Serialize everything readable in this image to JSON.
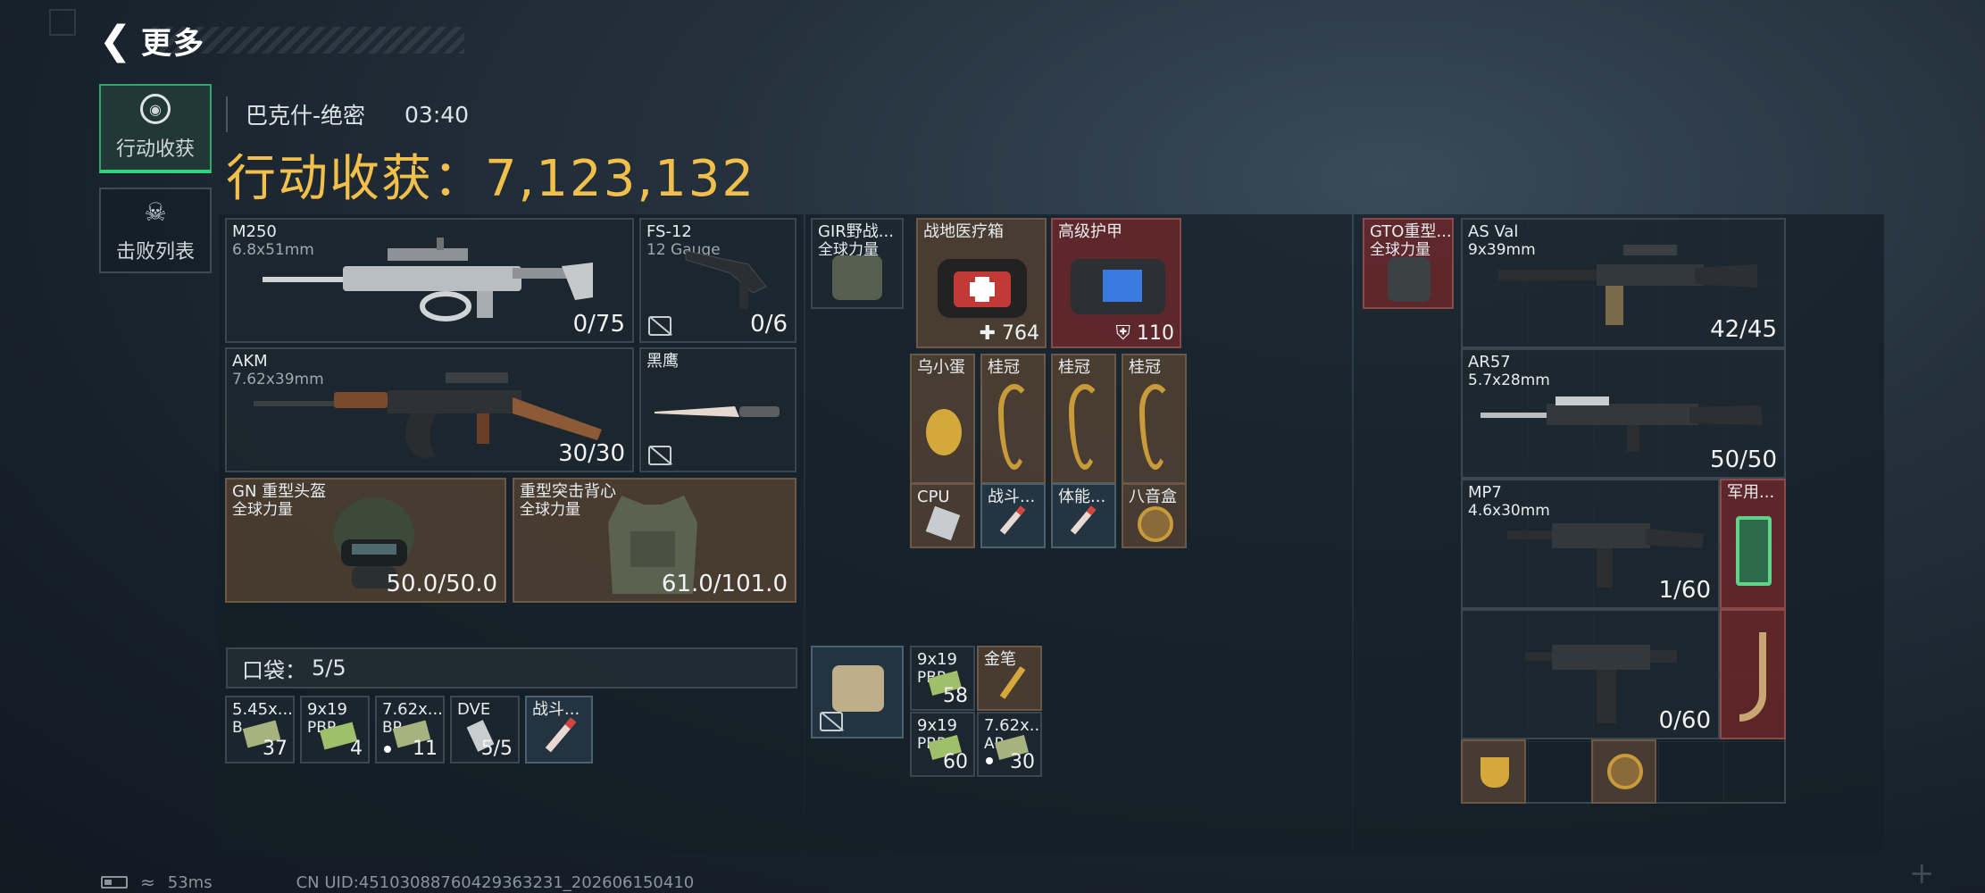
{
  "header": {
    "title": "更多"
  },
  "tabs": [
    {
      "label": "行动收获",
      "icon": "target-icon"
    },
    {
      "label": "击败列表",
      "icon": "skull-icon"
    }
  ],
  "raid": {
    "map": "巴克什-绝密",
    "time": "03:40",
    "harvest_label": "行动收获：",
    "harvest_value": "7,123,132"
  },
  "gear": {
    "m250": {
      "name": "M250",
      "caliber": "6.8x51mm",
      "ammo": "0/75"
    },
    "fs12": {
      "name": "FS-12",
      "caliber": "12 Gauge",
      "ammo": "0/6"
    },
    "akm": {
      "name": "AKM",
      "caliber": "7.62x39mm",
      "ammo": "30/30"
    },
    "knife": {
      "name": "黑鹰"
    },
    "helmet": {
      "name": "GN 重型头盔",
      "sub": "全球力量",
      "dur": "50.0/50.0"
    },
    "armor": {
      "name": "重型突击背心",
      "sub": "全球力量",
      "dur": "61.0/101.0"
    }
  },
  "pocket": {
    "label": "口袋：",
    "count": "5/5",
    "items": [
      {
        "name": "5.45x...",
        "sub": "B",
        "count": "37"
      },
      {
        "name": "9x19",
        "sub": "PBP",
        "count": "4"
      },
      {
        "name": "7.62x...",
        "sub": "BP",
        "count": "11"
      },
      {
        "name": "DVE",
        "sub": "",
        "count": "5/5"
      },
      {
        "name": "战斗...",
        "sub": "",
        "count": ""
      }
    ]
  },
  "rig": {
    "chest": {
      "name": "GIR野战...",
      "sub": "全球力量"
    },
    "medkit": {
      "name": "战地医疗箱",
      "count": "764"
    },
    "bag": {
      "name": "高级护甲",
      "count": "110"
    },
    "items": [
      {
        "name": "乌小蛋"
      },
      {
        "name": "桂冠"
      },
      {
        "name": "桂冠"
      },
      {
        "name": "桂冠"
      },
      {
        "name": "CPU"
      },
      {
        "name": "战斗..."
      },
      {
        "name": "体能..."
      },
      {
        "name": "八音盒"
      }
    ],
    "ammo": [
      {
        "name": "9x19",
        "sub": "PBP",
        "count": "58"
      },
      {
        "name": "金笔",
        "sub": "",
        "count": ""
      },
      {
        "name": "9x19",
        "sub": "PBP",
        "count": "60"
      },
      {
        "name": "7.62x...",
        "sub": "AP",
        "count": "30"
      }
    ]
  },
  "backpack": {
    "bag": {
      "name": "GTO重型...",
      "sub": "全球力量"
    },
    "asval": {
      "name": "AS Val",
      "caliber": "9x39mm",
      "ammo": "42/45"
    },
    "ar57": {
      "name": "AR57",
      "caliber": "5.7x28mm",
      "ammo": "50/50"
    },
    "mp7": {
      "name": "MP7",
      "caliber": "4.6x30mm",
      "ammo": "1/60"
    },
    "mil": {
      "name": "军用..."
    },
    "smg": {
      "ammo": "0/60"
    }
  },
  "footer": {
    "ping": "53ms",
    "uid": "CN UID:4510308876042936323​1_202606150410"
  }
}
